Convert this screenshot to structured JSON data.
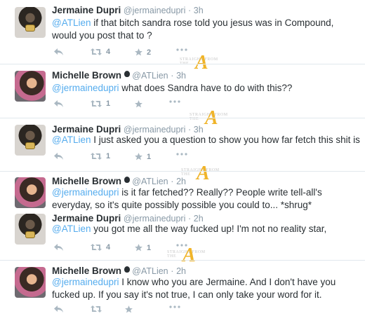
{
  "tweets": [
    {
      "name": "Jermaine Dupri",
      "handle": "@jermainedupri",
      "time": "3h",
      "verified_apple": false,
      "mention": "@ATLien",
      "text": " if that bitch sandra rose told you jesus was in Compound, would you post that to  ?",
      "retweets": "4",
      "favorites": "2"
    },
    {
      "name": "Michelle Brown",
      "handle": "@ATLien",
      "time": "3h",
      "verified_apple": true,
      "mention": "@jermainedupri",
      "text": " what does Sandra have to do with this??",
      "retweets": "1",
      "favorites": ""
    },
    {
      "name": "Jermaine Dupri",
      "handle": "@jermainedupri",
      "time": "3h",
      "verified_apple": false,
      "mention": "@ATLien",
      "text": " I just asked you a question to show you how far fetch this shit is",
      "retweets": "1",
      "favorites": "1"
    },
    {
      "name": "Michelle Brown",
      "handle": "@ATLien",
      "time": "2h",
      "verified_apple": true,
      "mention": "@jermainedupri",
      "text": " is it far fetched?? Really?? People write tell-all's everyday, so it's quite possibly possible you could to... *shrug*",
      "retweets": "",
      "favorites": ""
    },
    {
      "name": "Jermaine Dupri",
      "handle": "@jermainedupri",
      "time": "2h",
      "verified_apple": false,
      "mention": "@ATLien",
      "text": " you got me all the way fucked up! I'm not no reality star,",
      "retweets": "4",
      "favorites": "1"
    },
    {
      "name": "Michelle Brown",
      "handle": "@ATLien",
      "time": "2h",
      "verified_apple": true,
      "mention": "@jermainedupri",
      "text": " I know who you are Jermaine. And I don't have you fucked up. If you say it's not true, I can only take your word for it.",
      "retweets": "",
      "favorites": ""
    }
  ],
  "icons": {
    "reply": "reply-icon",
    "retweet": "retweet-icon",
    "favorite": "star-icon",
    "more": "more-icon",
    "apple": "apple-icon"
  },
  "watermark": {
    "text": "STRAIGHT FROM THE",
    "letter": "A"
  },
  "colors": {
    "link": "#55acee",
    "meta": "#8899a6",
    "watermark_gold": "#f0b429"
  }
}
